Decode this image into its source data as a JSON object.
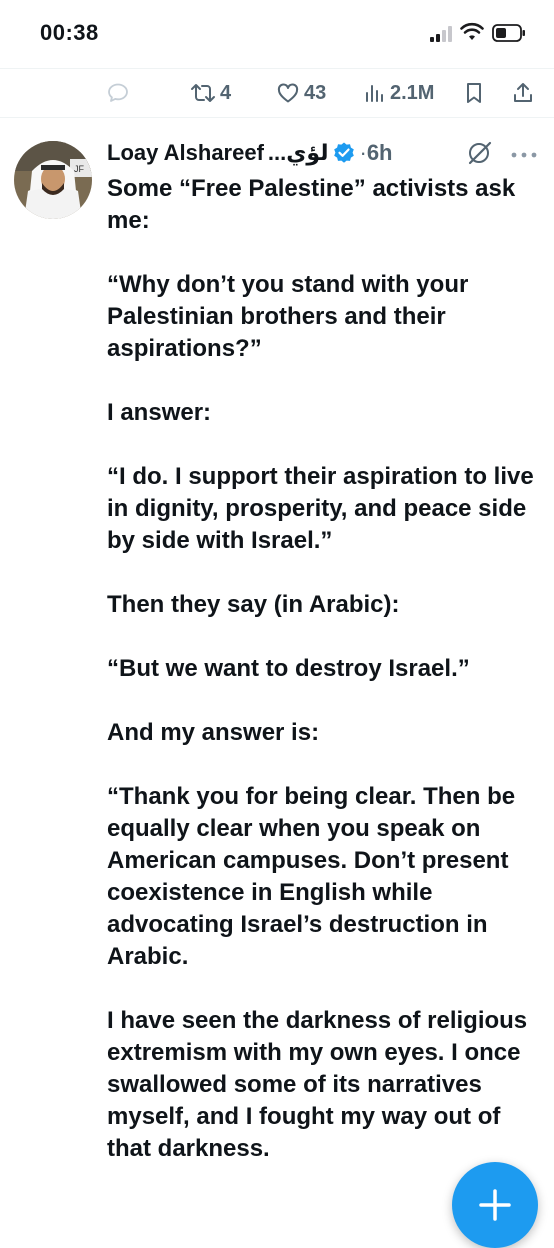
{
  "status_bar": {
    "time": "00:38"
  },
  "actions": {
    "reply_count": "",
    "retweet_count": "4",
    "like_count": "43",
    "views_count": "2.1M"
  },
  "tweet": {
    "author_name": "Loay Alshareef",
    "author_name_arabic": "لؤي...",
    "time_ago": "6h",
    "paragraphs": [
      "Some “Free Palestine” activists ask me:",
      "“Why don’t you stand with your Palestinian brothers and their aspirations?”",
      "I answer:",
      "“I do. I support their aspiration to live in dignity, prosperity, and peace side by side with Israel.”",
      "Then they say (in Arabic):",
      "“But we want to destroy Israel.”",
      "And my answer is:",
      "“Thank you for being clear. Then be equally clear when you speak on American campuses. Don’t present coexistence in English while advocating Israel’s destruction in Arabic.",
      "I have seen the darkness of religious extremism with my own eyes. I once swallowed some of its narratives myself, and I fought my way out of that darkness."
    ]
  },
  "colors": {
    "accent": "#1d9bf0",
    "secondary_text": "#536471",
    "primary_text": "#0f1419",
    "divider": "#eff3f4"
  },
  "icons": [
    "reply-icon",
    "retweet-icon",
    "like-icon",
    "views-icon",
    "bookmark-icon",
    "share-icon",
    "verified-badge-icon",
    "grok-icon",
    "more-icon",
    "compose-icon"
  ]
}
